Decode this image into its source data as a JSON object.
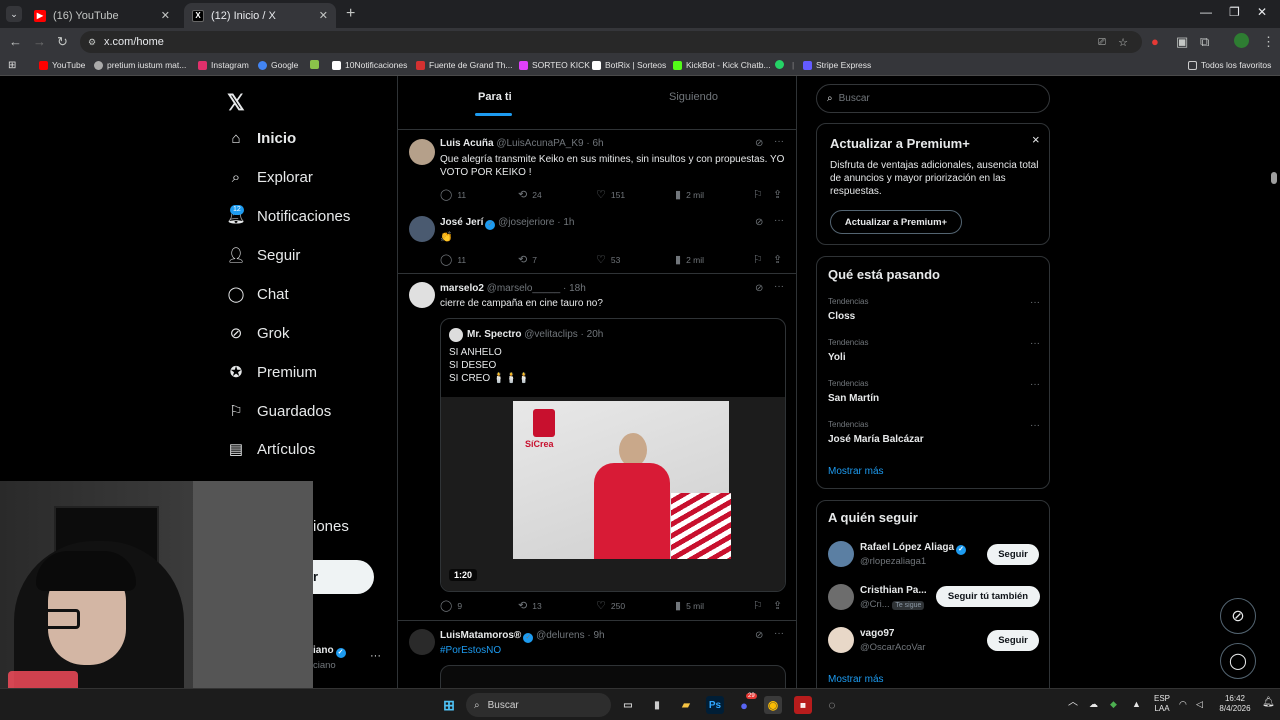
{
  "browser": {
    "tabs": [
      {
        "title": "(16) YouTube",
        "favicon": "youtube-icon",
        "active": false
      },
      {
        "title": "(12) Inicio / X",
        "favicon": "x-icon",
        "active": true
      }
    ],
    "url": "x.com/home",
    "bookmarks": [
      {
        "label": "YouTube",
        "color": "#ff0000"
      },
      {
        "label": "pretium iustum mat...",
        "color": "#aaaaaa"
      },
      {
        "label": "Instagram",
        "color": "#e1306c"
      },
      {
        "label": "Google",
        "color": "#4285f4"
      },
      {
        "label": "10Notificaciones",
        "color": "#ffffff"
      },
      {
        "label": "Fuente de Grand Th...",
        "color": "#d43131"
      },
      {
        "label": "SORTEO KICK",
        "color": "#e040fb"
      },
      {
        "label": "BotRix | Sorteos",
        "color": "#ffffff"
      },
      {
        "label": "KickBot - Kick Chatb...",
        "color": "#53fc18"
      },
      {
        "label": "Stripe Express",
        "color": "#635bff"
      }
    ],
    "bookmarks_other": "Todos los favoritos"
  },
  "nav": {
    "items": [
      {
        "label": "Inicio",
        "icon": "home-icon"
      },
      {
        "label": "Explorar",
        "icon": "search-icon"
      },
      {
        "label": "Notificaciones",
        "icon": "bell-icon"
      },
      {
        "label": "Seguir",
        "icon": "follow-icon"
      },
      {
        "label": "Chat",
        "icon": "chat-icon"
      },
      {
        "label": "Grok",
        "icon": "grok-icon"
      },
      {
        "label": "Premium",
        "icon": "premium-icon"
      },
      {
        "label": "Guardados",
        "icon": "bookmark-icon"
      },
      {
        "label": "Artículos",
        "icon": "article-icon"
      }
    ],
    "notif_count": "12",
    "partial_label": "iones",
    "profile_name_partial": "iano",
    "profile_handle_partial": "ciano",
    "profile_more": "···"
  },
  "feed": {
    "tabs": [
      "Para ti",
      "Siguiendo"
    ],
    "posts": [
      {
        "name": "Luis Acuña",
        "handle": "@LuisAcunaPA_K9",
        "time": "· 6h",
        "text": "Que alegría transmite Keiko en sus mitines, sin insultos y con propuestas. YO VOTO POR KEIKO !",
        "replies": "11",
        "reposts": "24",
        "likes": "151",
        "views": "2 mil"
      },
      {
        "name": "José Jerí",
        "handle": "@josejeriore",
        "time": "· 1h",
        "text": "👏",
        "replies": "11",
        "reposts": "7",
        "likes": "53",
        "views": "2 mil"
      },
      {
        "name": "marselo2",
        "handle": "@marselo_____",
        "time": "· 18h",
        "text": "cierre de campaña en cine tauro no?",
        "replies": "9",
        "reposts": "13",
        "likes": "250",
        "views": "5 mil",
        "quote": {
          "name": "Mr. Spectro",
          "handle": "@velitaclips",
          "time": "· 20h",
          "lines": [
            "SI ANHELO",
            "SI DESEO",
            "SI CREO 🕯️🕯️🕯️"
          ],
          "duration": "1:20",
          "video_logo": "SíCrea"
        }
      },
      {
        "name": "LuisMatamoros®",
        "handle": "@delurens",
        "time": "· 9h",
        "text": "#PorEstosNO"
      }
    ]
  },
  "right": {
    "search_placeholder": "Buscar",
    "premium": {
      "title": "Actualizar a Premium+",
      "body": "Disfruta de ventajas adicionales, ausencia total de anuncios y mayor priorización en las respuestas.",
      "button": "Actualizar a Premium+",
      "close": "×"
    },
    "trends": {
      "title": "Qué está pasando",
      "items": [
        {
          "category": "Tendencias",
          "name": "Closs"
        },
        {
          "category": "Tendencias",
          "name": "Yoli"
        },
        {
          "category": "Tendencias",
          "name": "San Martín"
        },
        {
          "category": "Tendencias",
          "name": "José María Balcázar"
        }
      ],
      "more": "Mostrar más"
    },
    "follow": {
      "title": "A quién seguir",
      "items": [
        {
          "name": "Rafael López Aliaga",
          "handle": "@rlopezaliaga1",
          "button": "Seguir",
          "verified": true
        },
        {
          "name": "Cristhian Pa...",
          "handle": "@Cri...",
          "badge": "Te sigue",
          "button": "Seguir tú también",
          "verified": false
        },
        {
          "name": "vago97",
          "handle": "@OscarAcoVar",
          "button": "Seguir",
          "verified": false
        }
      ],
      "more": "Mostrar más"
    }
  },
  "taskbar": {
    "search": "Buscar",
    "lang": "ESP",
    "region": "LAA",
    "time": "16:42",
    "date": "8/4/2026",
    "discord_badge": "29"
  }
}
